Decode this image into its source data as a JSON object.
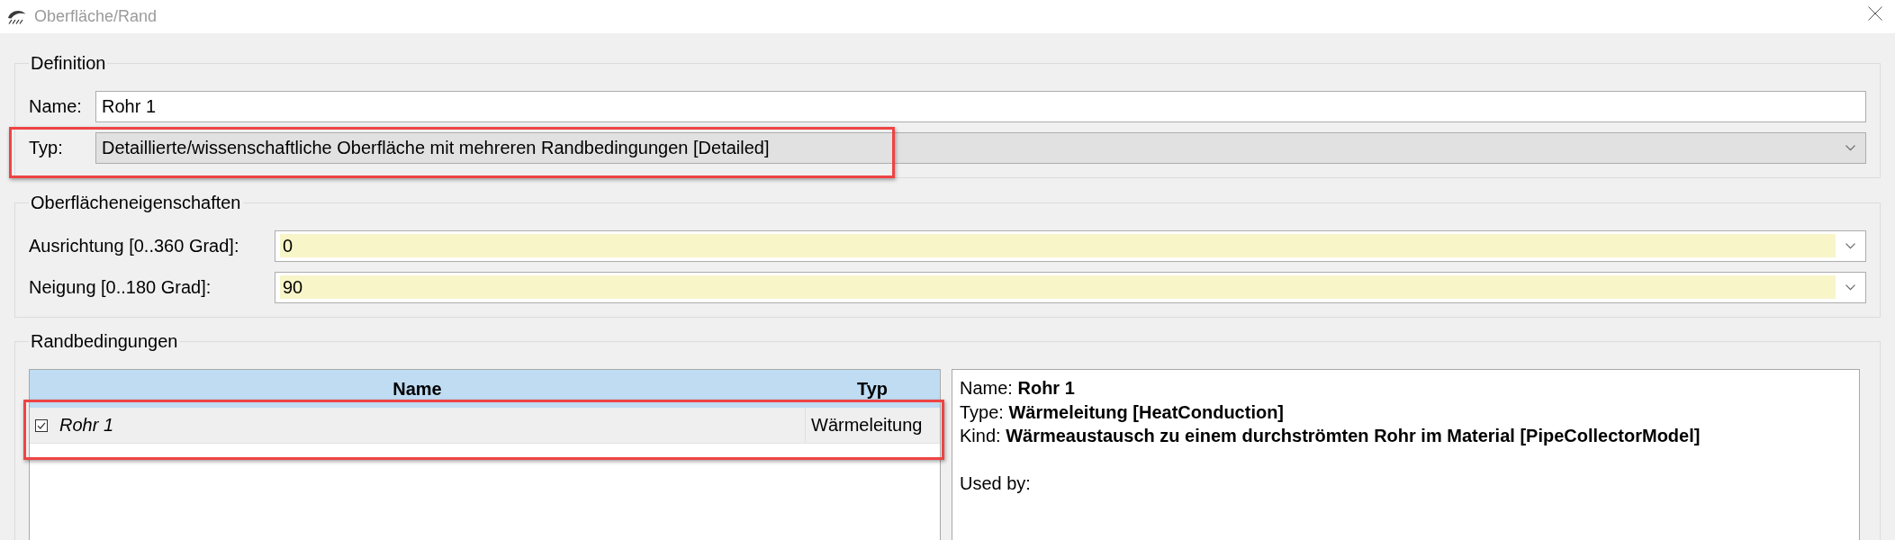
{
  "window": {
    "title": "Oberfläche/Rand"
  },
  "definition": {
    "title": "Definition",
    "fields": [
      {
        "kind": "text",
        "label": "Name:",
        "value": "Rohr 1"
      },
      {
        "kind": "dropdown",
        "label": "Typ:",
        "value": "Detaillierte/wissenschaftliche Oberfläche mit mehreren Randbedingungen [Detailed]",
        "highlighted": true
      }
    ]
  },
  "surface_properties": {
    "title": "Oberflächeneigenschaften",
    "fields": [
      {
        "label": "Ausrichtung [0..360 Grad]:",
        "value": "0"
      },
      {
        "label": "Neigung [0..180 Grad]:",
        "value": "90"
      }
    ]
  },
  "boundary_conditions": {
    "title": "Randbedingungen",
    "table": {
      "columns": [
        "Name",
        "Typ"
      ],
      "rows": [
        {
          "name": "Rohr 1",
          "type": "Wärmeleitung",
          "checked": true,
          "highlighted": true
        }
      ]
    },
    "details": {
      "lines": [
        "Name: **Rohr 1**",
        "Type: **Wärmeleitung [HeatConduction]**",
        "Kind: **Wärmeaustausch zu einem durchströmten Rohr im Material [PipeCollectorModel]**"
      ],
      "used_by": "Used by:"
    }
  }
}
